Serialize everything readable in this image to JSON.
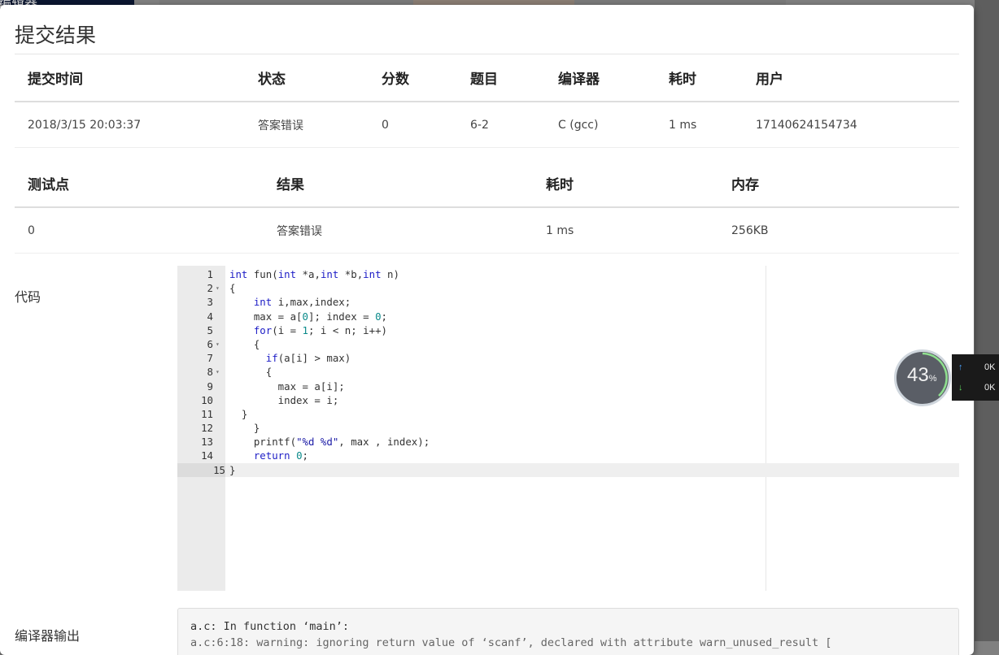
{
  "background": {
    "nav_text": "编辑器"
  },
  "modal": {
    "title": "提交结果"
  },
  "submission_table": {
    "headers": [
      "提交时间",
      "状态",
      "分数",
      "题目",
      "编译器",
      "耗时",
      "用户"
    ],
    "row": {
      "time": "2018/3/15 20:03:37",
      "status": "答案错误",
      "score": "0",
      "problem": "6-2",
      "compiler": "C (gcc)",
      "duration": "1 ms",
      "user": "17140624154734"
    }
  },
  "testcase_table": {
    "headers": [
      "测试点",
      "结果",
      "耗时",
      "内存"
    ],
    "row": {
      "case": "0",
      "result": "答案错误",
      "duration": "1 ms",
      "memory": "256KB"
    }
  },
  "code": {
    "label": "代码",
    "lines": [
      {
        "n": "1",
        "fold": "",
        "text": "int fun(int *a,int *b,int n)"
      },
      {
        "n": "2",
        "fold": "▾",
        "text": "{"
      },
      {
        "n": "3",
        "fold": "",
        "text": "    int i,max,index;"
      },
      {
        "n": "4",
        "fold": "",
        "text": "    max = a[0]; index = 0;"
      },
      {
        "n": "5",
        "fold": "",
        "text": "    for(i = 1; i < n; i++)"
      },
      {
        "n": "6",
        "fold": "▾",
        "text": "    {"
      },
      {
        "n": "7",
        "fold": "",
        "text": "      if(a[i] > max)"
      },
      {
        "n": "8",
        "fold": "▾",
        "text": "      {"
      },
      {
        "n": "9",
        "fold": "",
        "text": "        max = a[i];"
      },
      {
        "n": "10",
        "fold": "",
        "text": "        index = i;"
      },
      {
        "n": "11",
        "fold": "",
        "text": "  }"
      },
      {
        "n": "12",
        "fold": "",
        "text": "    }"
      },
      {
        "n": "13",
        "fold": "",
        "text": "    printf(\"%d %d\", max , index);"
      },
      {
        "n": "14",
        "fold": "",
        "text": "    return 0;"
      },
      {
        "n": "15",
        "fold": "",
        "text": "}"
      }
    ]
  },
  "compiler_output": {
    "label": "编译器输出",
    "line1": "a.c: In function ‘main’:",
    "line2": "a.c:6:18: warning: ignoring return value of ‘scanf’, declared with attribute warn_unused_result ["
  },
  "net_widget": {
    "percent": "43",
    "percent_sign": "%",
    "up": "0K",
    "down": "0K"
  }
}
